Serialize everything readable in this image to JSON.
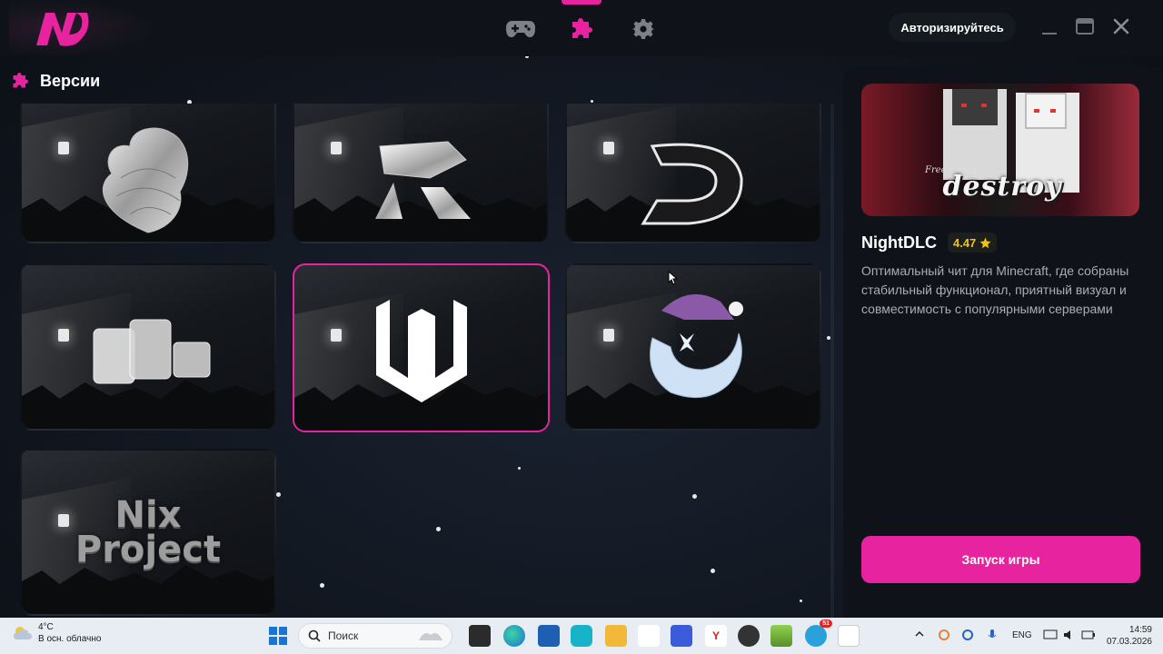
{
  "titlebar": {
    "logo_text": "N",
    "nav": [
      {
        "name": "games",
        "icon": "gamepad-icon"
      },
      {
        "name": "versions",
        "icon": "puzzle-icon",
        "active": true
      },
      {
        "name": "settings",
        "icon": "gear-icon"
      }
    ],
    "auth_label": "Авторизируйтесь"
  },
  "section": {
    "title": "Версии",
    "icon": "puzzle-icon"
  },
  "versions": [
    {
      "emblem": "heart-chrome"
    },
    {
      "emblem": "r-chrome"
    },
    {
      "emblem": "d-chrome"
    },
    {
      "emblem": "blocks-chrome"
    },
    {
      "emblem": "w-logo",
      "selected": true
    },
    {
      "emblem": "moon-hat"
    },
    {
      "emblem": "nix-project",
      "label": "Nix Project"
    }
  ],
  "product": {
    "name": "NightDLC",
    "rating": "4.47",
    "description": "Оптимальный чит для Minecraft, где собраны стабильный функционал, приятный визуал и совместимость с популярными серверами",
    "preview_title": "destroy",
    "preview_subtitle": "Free Client 2.0",
    "launch_label": "Запуск игры"
  },
  "taskbar": {
    "weather_temp": "4°C",
    "weather_desc": "В осн. облачно",
    "search_placeholder": "Поиск",
    "lang": "ENG",
    "time": "14:59",
    "date": "07.03.2026",
    "telegram_badge": "51"
  },
  "colors": {
    "accent": "#e8239f",
    "background": "#11161f",
    "panel": "#0f1319"
  }
}
